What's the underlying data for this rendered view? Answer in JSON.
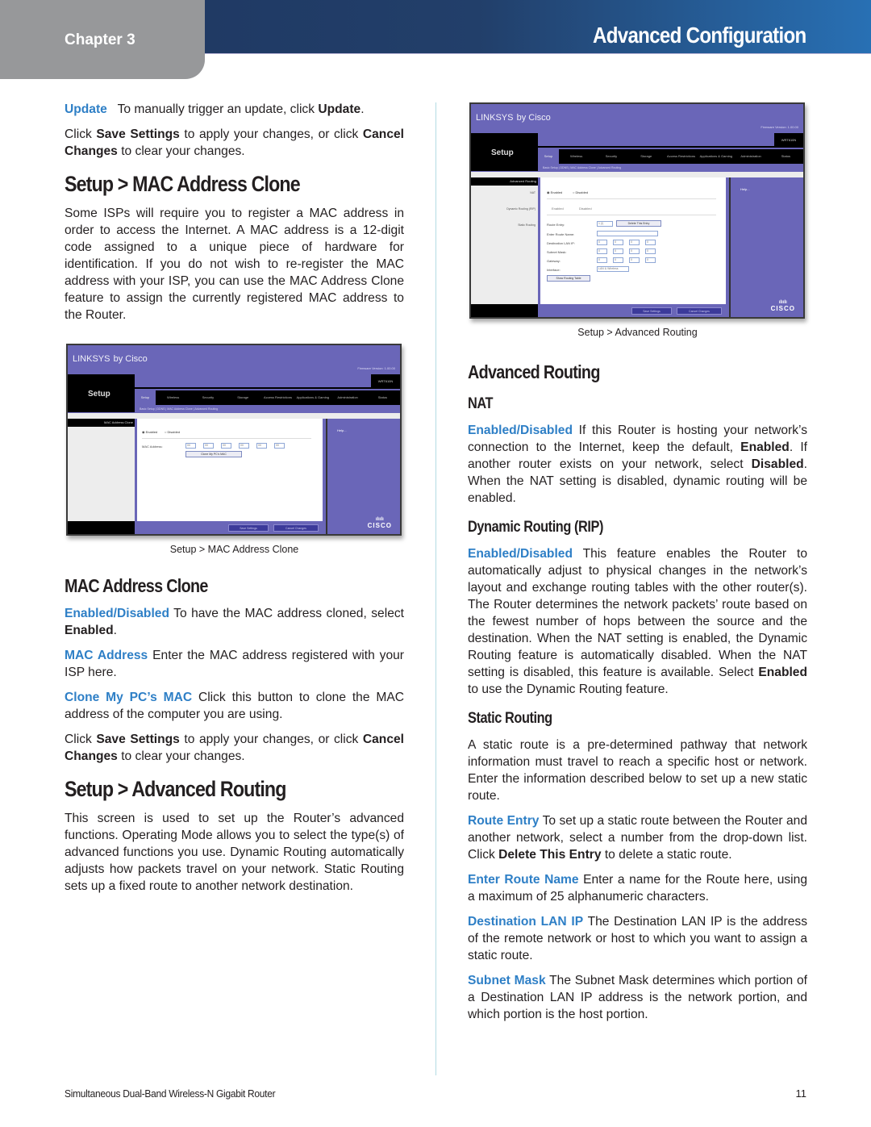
{
  "header": {
    "chapter": "Chapter 3",
    "title": "Advanced Configuration"
  },
  "left": {
    "update": {
      "term": "Update",
      "text_before": "To manually trigger an update, click ",
      "bold": "Update",
      "text_after": "."
    },
    "save_note_1": {
      "text1": "Click ",
      "b1": "Save Settings",
      "text2": " to apply your changes, or click ",
      "b2": "Cancel Changes",
      "text3": " to clear your changes."
    },
    "mac_clone_heading": "Setup > MAC Address Clone",
    "mac_clone_intro": "Some ISPs will require you to register a MAC address in order to access the Internet. A MAC address is a 12-digit code assigned to a unique piece of hardware for identification. If you do not wish to re-register the MAC address with your ISP, you can use the MAC Address Clone feature to assign the currently registered MAC address to the Router.",
    "mac_clone_caption": "Setup > MAC Address Clone",
    "mac_clone_subheading": "MAC Address Clone",
    "enabled_disabled": {
      "term": "Enabled/Disabled",
      "text": " To have the MAC address cloned, select ",
      "bold": "Enabled",
      "after": "."
    },
    "mac_address": {
      "term": "MAC Address",
      "text": " Enter the MAC address registered with your ISP here."
    },
    "clone_my_pc": {
      "term": "Clone My PC’s MAC",
      "text": " Click this button to clone the MAC address of the computer you are using."
    },
    "save_note_2": {
      "text1": "Click ",
      "b1": "Save Settings",
      "text2": " to apply your changes, or click ",
      "b2": "Cancel Changes",
      "text3": " to clear your changes."
    },
    "adv_routing_heading": "Setup > Advanced Routing",
    "adv_routing_intro": "This screen is used to set up the Router’s advanced functions. Operating Mode allows you to select the type(s) of advanced functions you use. Dynamic Routing automatically adjusts how packets travel on your network. Static Routing sets up a fixed route to another network destination."
  },
  "right": {
    "adv_routing_caption": "Setup > Advanced Routing",
    "adv_routing_heading": "Advanced Routing",
    "nat_heading": "NAT",
    "nat_enabled": {
      "term": "Enabled/Disabled",
      "text1": "  If this Router is hosting your network’s connection to the Internet, keep the default, ",
      "b1": "Enabled",
      "text2": ". If another router exists on your network, select ",
      "b2": "Disabled",
      "text3": ". When the NAT setting is disabled, dynamic routing will be enabled."
    },
    "rip_heading": "Dynamic Routing (RIP)",
    "rip_enabled": {
      "term": "Enabled/Disabled",
      "text1": " This feature enables the Router to automatically adjust to physical changes in the network’s layout and exchange routing tables with the other router(s). The Router determines the network packets’ route based on the fewest number of hops between the source and the destination. When the NAT setting is enabled, the Dynamic Routing feature is automatically disabled. When the NAT setting is disabled, this feature is available. Select ",
      "b1": "Enabled",
      "text2": " to use the Dynamic Routing feature."
    },
    "static_heading": "Static Routing",
    "static_intro": "A static route is a pre-determined pathway that network information must travel to reach a specific host or network. Enter the information described below to set up a new static route.",
    "route_entry": {
      "term": "Route Entry",
      "text1": "  To set up a static route between the Router and another network, select a number from the drop-down list. Click ",
      "b1": "Delete This Entry",
      "text2": " to delete a static route."
    },
    "route_name": {
      "term": "Enter Route Name",
      "text": " Enter a name for the Route here, using a maximum of 25 alphanumeric characters."
    },
    "dest_lan_ip": {
      "term": "Destination LAN IP",
      "text": "  The Destination LAN IP is the address of the remote network or host to which you want to assign a static route."
    },
    "subnet_mask": {
      "term": "Subnet Mask",
      "text": " The Subnet Mask determines which portion of a Destination LAN IP address is the network portion, and which portion is the host portion."
    }
  },
  "screenshots": {
    "common": {
      "logo": "LINKSYS",
      "logo_suffix": "by Cisco",
      "firmware": "Firmware Version: 1.00.00",
      "model": "WRT610N",
      "section": "Setup",
      "tabs": [
        "Setup",
        "Wireless",
        "Security",
        "Storage",
        "Access Restrictions",
        "Applications & Gaming",
        "Administration",
        "Status"
      ],
      "subtabs": "Basic Setup  |  DDNS  |  MAC Address Clone  |  Advanced Routing",
      "help": "Help...",
      "cisco": "CISCO",
      "cisco_bars": "ılıılı",
      "save": "Save Settings",
      "cancel": "Cancel Changes"
    },
    "mac_clone": {
      "sidebar_title": "MAC Address Clone",
      "radio_enabled": "◉ Enabled",
      "radio_disabled": "○ Disabled",
      "mac_label": "MAC Address:",
      "mac_values": [
        "00",
        "00",
        "00",
        "00",
        "00",
        "00"
      ],
      "clone_button": "Clone My PC's MAC"
    },
    "adv_routing": {
      "sidebar_title": "Advanced Routing",
      "side_nat": "NAT",
      "side_rip": "Dynamic Routing (RIP)",
      "side_static": "Static Routing",
      "nat_enabled": "◉ Enabled",
      "nat_disabled": "○ Disabled",
      "rip_enabled": "Enabled",
      "rip_disabled": "Disabled",
      "route_entry_label": "Route Entry:",
      "route_entry_value": "1 (!)",
      "delete_button": "Delete This Entry",
      "route_name_label": "Enter Route Name:",
      "dest_label": "Destination LAN IP:",
      "dest_values": [
        "0",
        "0",
        "0",
        "0"
      ],
      "subnet_label": "Subnet Mask:",
      "subnet_values": [
        "0",
        "0",
        "0",
        "0"
      ],
      "gateway_label": "Gateway:",
      "gateway_values": [
        "0",
        "0",
        "0",
        "0"
      ],
      "interface_label": "Interface:",
      "interface_value": "LAN & Wireless",
      "show_table_button": "Show Routing Table"
    }
  },
  "footer": {
    "product": "Simultaneous Dual-Band Wireless-N Gigabit Router",
    "page": "11"
  }
}
